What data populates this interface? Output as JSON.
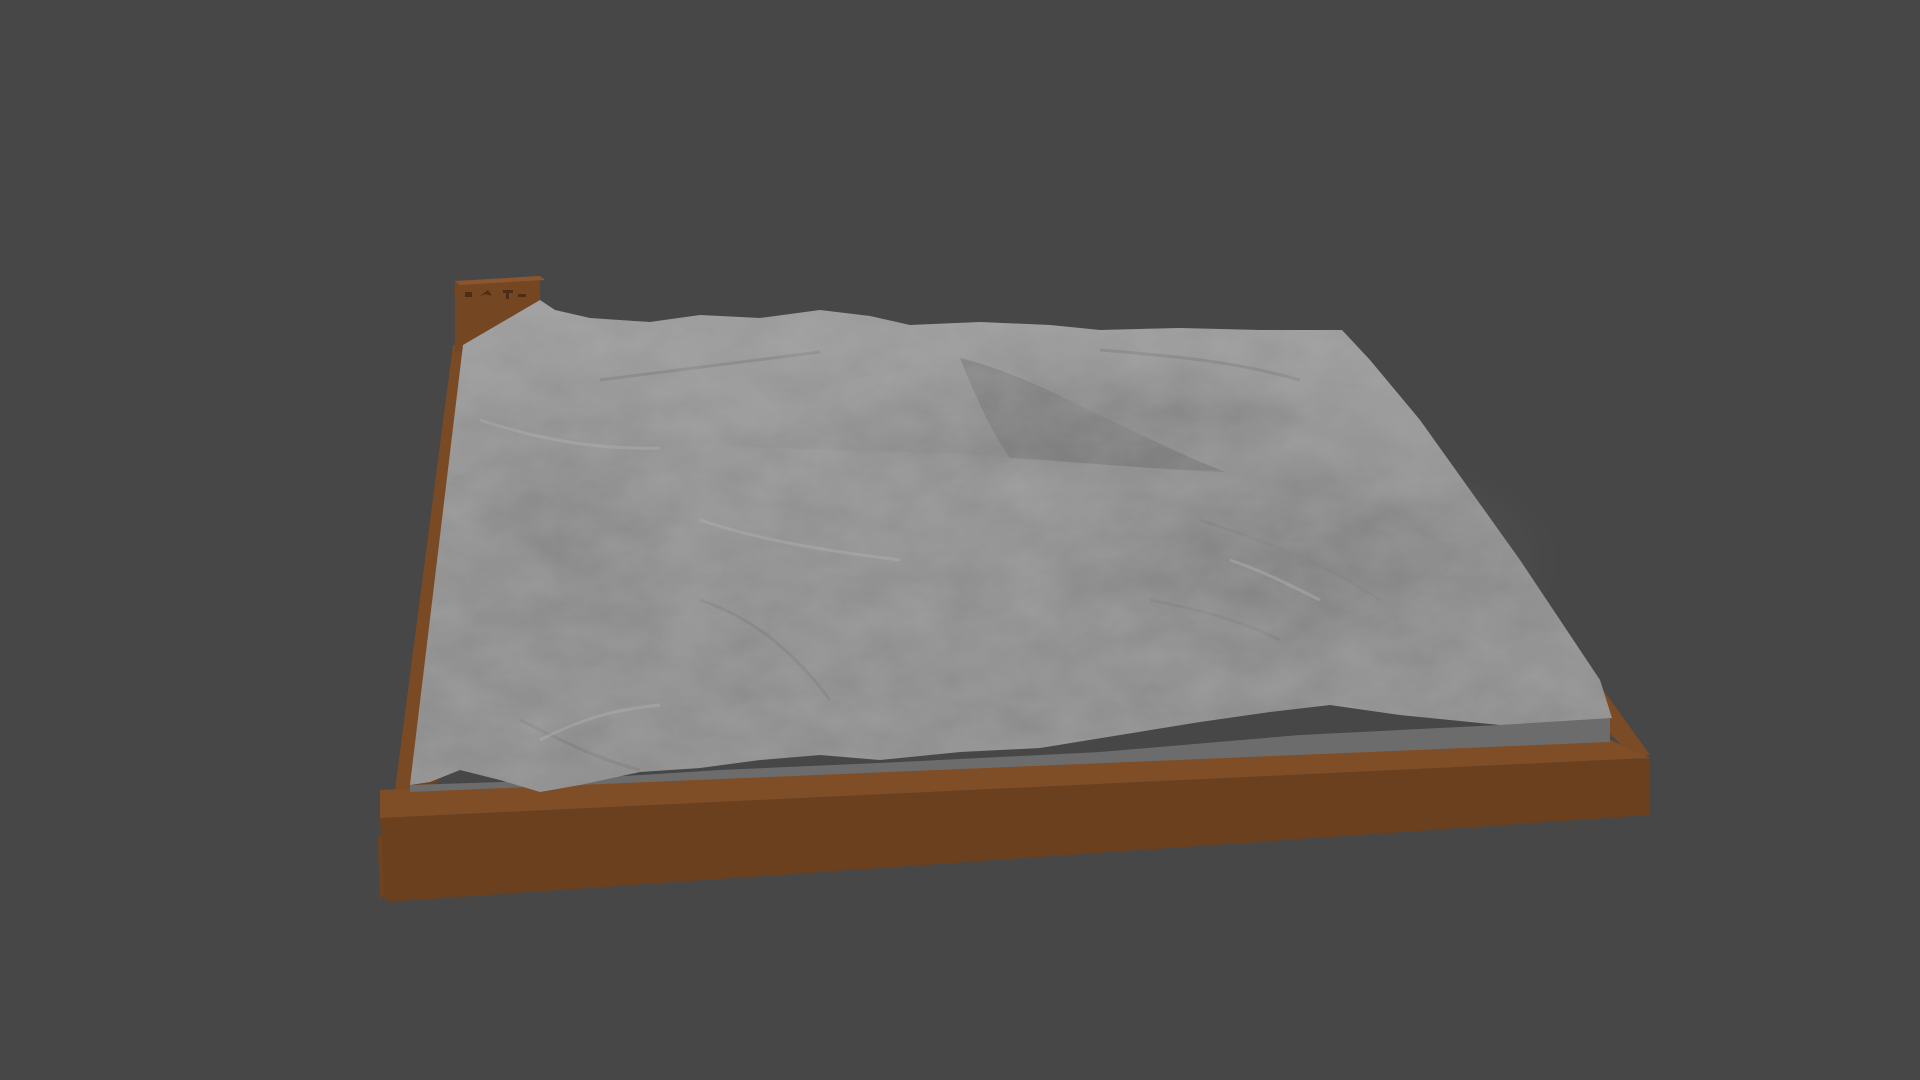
{
  "viewport": {
    "background": "#474747"
  },
  "model": {
    "terrain_color": "#8b8b8b",
    "base_color": "#6b4121",
    "label_block_color": "#784a26"
  }
}
